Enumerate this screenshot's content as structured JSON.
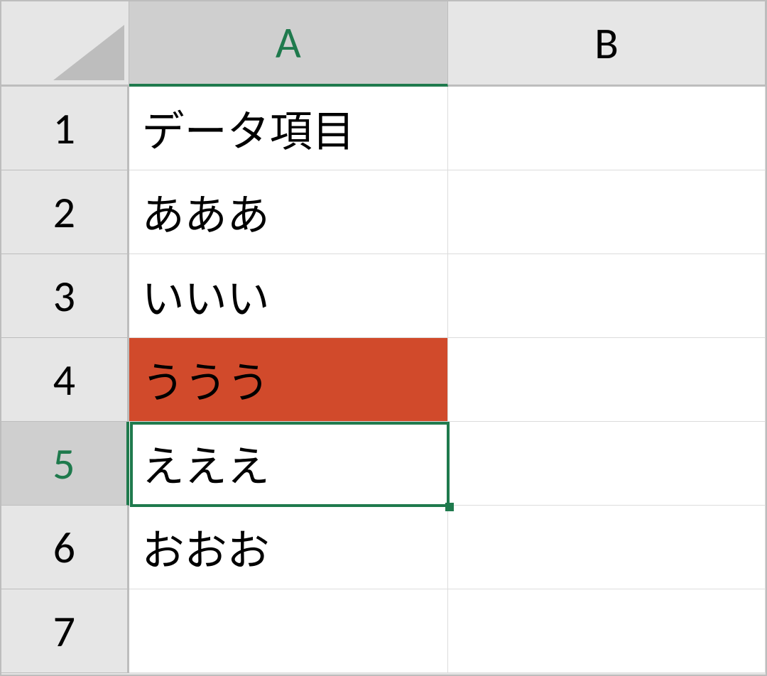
{
  "columns": {
    "A": "A",
    "B": "B"
  },
  "rowLabels": {
    "1": "1",
    "2": "2",
    "3": "3",
    "4": "4",
    "5": "5",
    "6": "6",
    "7": "7"
  },
  "cells": {
    "A1": "データ項目",
    "A2": "あああ",
    "A3": "いいい",
    "A4": "ううう",
    "A5": "えええ",
    "A6": "おおお",
    "A7": "",
    "B1": "",
    "B2": "",
    "B3": "",
    "B4": "",
    "B5": "",
    "B6": "",
    "B7": ""
  },
  "activeColumn": "A",
  "activeRow": "5",
  "selectedCell": "A5",
  "highlightCell": "A4",
  "colors": {
    "highlightFill": "#d14a2b",
    "selectionBorder": "#1f7a4d"
  }
}
